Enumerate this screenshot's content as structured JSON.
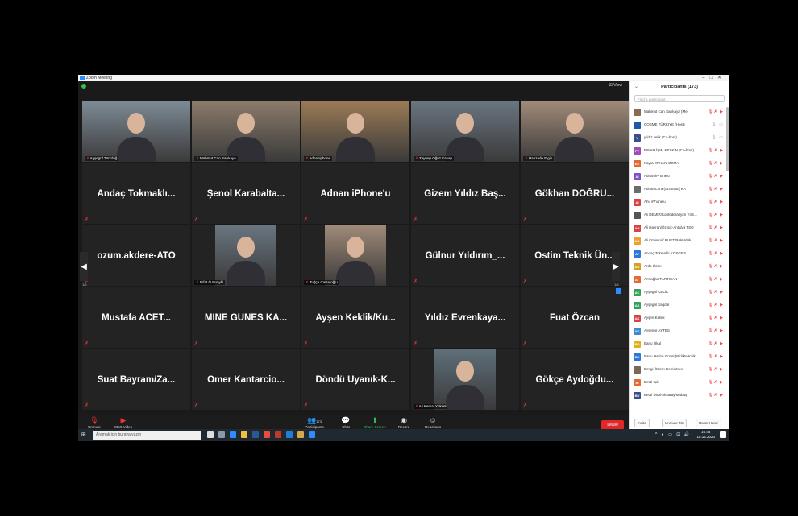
{
  "window": {
    "title": "Zoom Meeting",
    "view_label": "⊞ View"
  },
  "grid": {
    "rows": [
      [
        {
          "type": "video",
          "label": "Ayşegül Türkdağ"
        },
        {
          "type": "video",
          "label": "Mahmut Can Sarıkaya"
        },
        {
          "type": "video",
          "label": "adnaniphone",
          "highlight": true
        },
        {
          "type": "video",
          "label": "Zeynep Oğuz Kasap"
        },
        {
          "type": "video",
          "label": "Hanzade Elgin"
        }
      ],
      [
        {
          "type": "name",
          "name": "Andaç Tokmaklı..."
        },
        {
          "type": "name",
          "name": "Şenol Karabalta..."
        },
        {
          "type": "name",
          "name": "Adnan iPhone'u"
        },
        {
          "type": "name",
          "name": "Gizem Yıldız Baş..."
        },
        {
          "type": "name",
          "name": "Gökhan DOĞRU..."
        }
      ],
      [
        {
          "type": "name",
          "name": "ozum.akdere-ATO"
        },
        {
          "type": "video",
          "label": "Rifat Ö Nuaybi"
        },
        {
          "type": "video",
          "label": "Tuğçe Cavuşoğlu"
        },
        {
          "type": "name",
          "name": "Gülnur Yıldırım_..."
        },
        {
          "type": "name",
          "name": "Ostim Teknik Ün..."
        }
      ],
      [
        {
          "type": "name",
          "name": "Mustafa ACET..."
        },
        {
          "type": "name",
          "name": "MINE GUNES KA..."
        },
        {
          "type": "name",
          "name": "Ayşen Keklik/Ku..."
        },
        {
          "type": "name",
          "name": "Yıldız Evrenkaya..."
        },
        {
          "type": "name",
          "name": "Fuat Özcan"
        }
      ],
      [
        {
          "type": "name",
          "name": "Suat Bayram/Za..."
        },
        {
          "type": "name",
          "name": "Omer Kantarcio..."
        },
        {
          "type": "name",
          "name": "Döndü Uyanık-K..."
        },
        {
          "type": "video",
          "label": "Ali Kemal Yüksel"
        },
        {
          "type": "name",
          "name": "Gökçe Aydoğdu..."
        }
      ]
    ],
    "pager_left": "1/6",
    "pager_right": "1/6"
  },
  "toolbar": {
    "unmute": "Unmute",
    "start_video": "Start Video",
    "participants": "Participants",
    "participants_count": "173",
    "chat": "Chat",
    "share_screen": "Share Screen",
    "record": "Record",
    "reactions": "Reactions",
    "leave": "Leave"
  },
  "panel": {
    "title": "Participants (173)",
    "search_placeholder": "Find a participant",
    "participants": [
      {
        "initials": "",
        "name": "Mahmut Can Sarıkaya (Me)",
        "color": "#8a6a50",
        "muted": true
      },
      {
        "initials": "",
        "name": "COSME TÜRKIYE (Host)",
        "color": "#1e5aa8",
        "muted": false
      },
      {
        "initials": "Y",
        "name": "yıldız.celik (Co-host)",
        "color": "#3b4d8a",
        "muted": false
      },
      {
        "initials": "PT",
        "name": "PINAR İŞIM KESKİN (Co-host)",
        "color": "#a24db5",
        "muted": true
      },
      {
        "initials": "KE",
        "name": "Kayra ERKAN-OSMA",
        "color": "#e26b35",
        "muted": true
      },
      {
        "initials": "AI",
        "name": "Adnan iPhone'u",
        "color": "#7a55c9",
        "muted": true
      },
      {
        "initials": "",
        "name": "Adnan Lora (ozcanlar) KA",
        "color": "#6b6b6b",
        "muted": true
      },
      {
        "initials": "AI",
        "name": "Ahu iPhone'u",
        "color": "#d64545",
        "muted": true
      },
      {
        "initials": "",
        "name": "Ali DEMİR/Konfederasyon YöS...",
        "color": "#555555",
        "muted": true
      },
      {
        "initials": "AH",
        "name": "Ali Hayran/Özışık-Antalya TSO",
        "color": "#d64545",
        "muted": true
      },
      {
        "initials": "AO",
        "name": "Ali Ozdemir/ RUET/Rektörlük",
        "color": "#f0a030",
        "muted": true
      },
      {
        "initials": "AT",
        "name": "Andaç Tokmaklı KOSGEB",
        "color": "#2d7ad6",
        "muted": true
      },
      {
        "initials": "AU",
        "name": "Arda Özen",
        "color": "#d6a020",
        "muted": true
      },
      {
        "initials": "AT",
        "name": "Armağan TARTIŞAN",
        "color": "#e26b35",
        "muted": true
      },
      {
        "initials": "AC",
        "name": "Ayşegül ÇELİK",
        "color": "#34a05a",
        "muted": true
      },
      {
        "initials": "AS",
        "name": "Ayşegül Sağdal",
        "color": "#34a05a",
        "muted": true
      },
      {
        "initials": "AK",
        "name": "Ayşen Keklik",
        "color": "#d64545",
        "muted": true
      },
      {
        "initials": "AK",
        "name": "Aysenur AYTEŞ",
        "color": "#3f8ad0",
        "muted": true
      },
      {
        "initials": "BO",
        "name": "Banu Ökal",
        "color": "#e0b020",
        "muted": true
      },
      {
        "initials": "BH",
        "name": "Banu Hafize Güzel (Birlikte Kalkı...",
        "color": "#2d7ad6",
        "muted": true
      },
      {
        "initials": "",
        "name": "Bengi Özlem Demirören",
        "color": "#7a6a55",
        "muted": true
      },
      {
        "initials": "BI",
        "name": "Betül Işık",
        "color": "#e26b35",
        "muted": true
      },
      {
        "initials": "BU",
        "name": "Betül Ünal-Aksaray/Mübaş",
        "color": "#3b4d8a",
        "muted": true
      }
    ],
    "footer": {
      "invite": "Invite",
      "unmute_me": "Unmute Me",
      "raise_hand": "Raise Hand"
    }
  },
  "taskbar": {
    "search_placeholder": "Aramak için buraya yazın",
    "time": "10:43",
    "date": "15.12.2020"
  }
}
